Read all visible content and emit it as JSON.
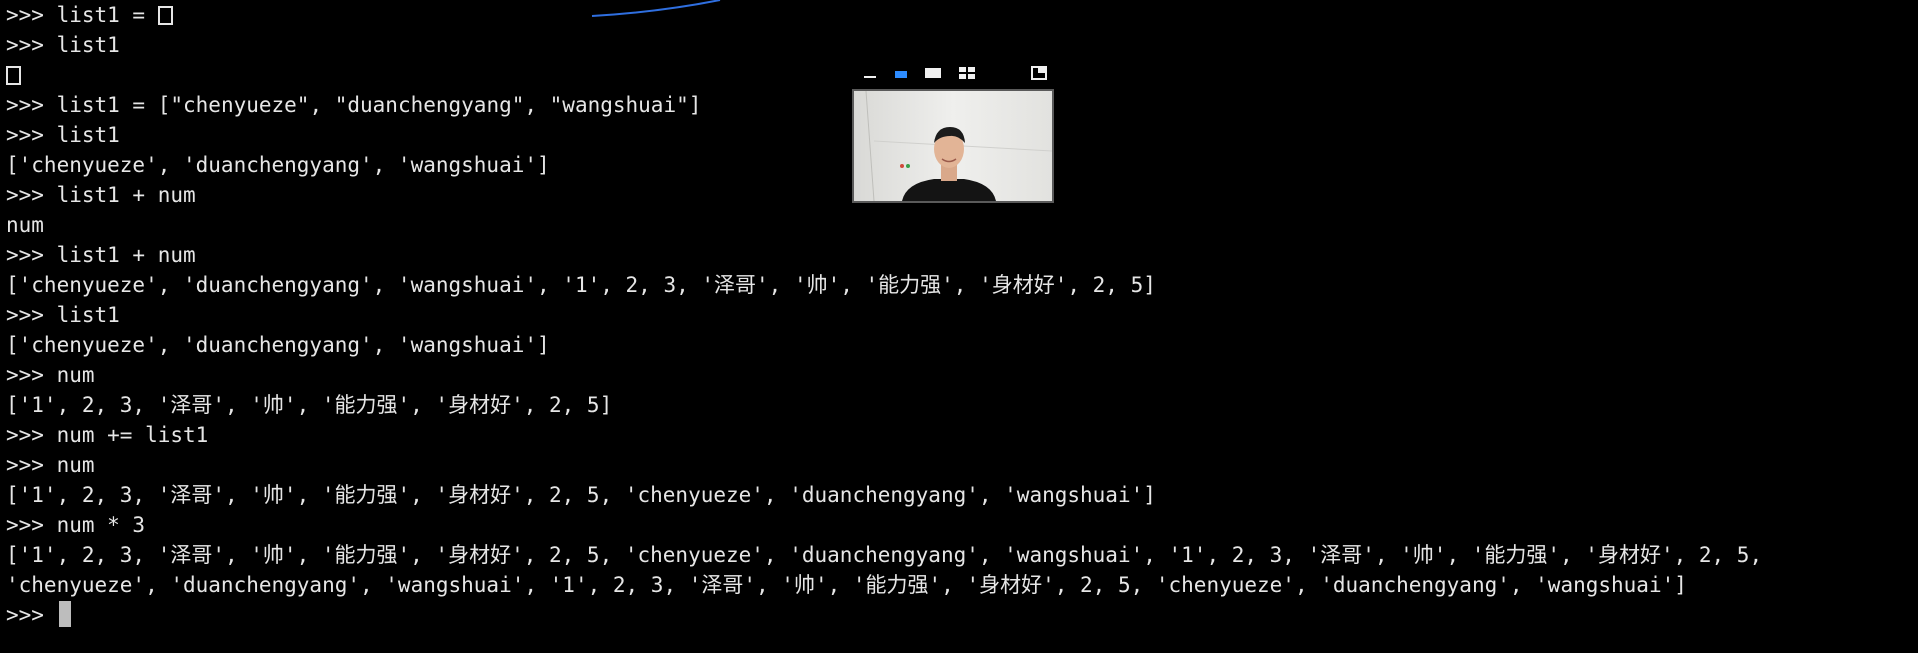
{
  "terminal": {
    "prompt": ">>> ",
    "lines": [
      {
        "kind": "input",
        "text": "list1 = []",
        "empty_list_glyph": true
      },
      {
        "kind": "input",
        "text": "list1"
      },
      {
        "kind": "output",
        "text": "[]",
        "empty_list_glyph": true
      },
      {
        "kind": "input",
        "text": "list1 = [\"chenyueze\", \"duanchengyang\", \"wangshuai\"]"
      },
      {
        "kind": "input",
        "text": "list1"
      },
      {
        "kind": "output",
        "text": "['chenyueze', 'duanchengyang', 'wangshuai']"
      },
      {
        "kind": "input",
        "text": "list1 + num"
      },
      {
        "kind": "output",
        "text": "num"
      },
      {
        "kind": "input",
        "text": "list1 + num"
      },
      {
        "kind": "output",
        "text": "['chenyueze', 'duanchengyang', 'wangshuai', '1', 2, 3, '泽哥', '帅', '能力强', '身材好', 2, 5]"
      },
      {
        "kind": "input",
        "text": "list1"
      },
      {
        "kind": "output",
        "text": "['chenyueze', 'duanchengyang', 'wangshuai']"
      },
      {
        "kind": "input",
        "text": "num"
      },
      {
        "kind": "output",
        "text": "['1', 2, 3, '泽哥', '帅', '能力强', '身材好', 2, 5]"
      },
      {
        "kind": "input",
        "text": "num += list1"
      },
      {
        "kind": "input",
        "text": "num"
      },
      {
        "kind": "output",
        "text": "['1', 2, 3, '泽哥', '帅', '能力强', '身材好', 2, 5, 'chenyueze', 'duanchengyang', 'wangshuai']"
      },
      {
        "kind": "input",
        "text": "num * 3"
      },
      {
        "kind": "output",
        "text": "['1', 2, 3, '泽哥', '帅', '能力强', '身材好', 2, 5, 'chenyueze', 'duanchengyang', 'wangshuai', '1', 2, 3, '泽哥', '帅', '能力强', '身材好', 2, 5,"
      },
      {
        "kind": "output",
        "text": "'chenyueze', 'duanchengyang', 'wangshuai', '1', 2, 3, '泽哥', '帅', '能力强', '身材好', 2, 5, 'chenyueze', 'duanchengyang', 'wangshuai']"
      },
      {
        "kind": "active_prompt",
        "text": ""
      }
    ]
  },
  "video_overlay": {
    "toolbar_icons": [
      "minimize-icon",
      "speaker-view-icon",
      "fullscreen-icon",
      "gallery-view-icon",
      "exit-pip-icon"
    ],
    "active_icon": "speaker-view-icon",
    "accent_color": "#2d8cff",
    "person_shirt_color": "#141414"
  },
  "colors": {
    "background": "#000000",
    "text": "#e6e6e6",
    "cursor": "#bdbdbd",
    "annotation_arc": "#2f6fe0"
  }
}
